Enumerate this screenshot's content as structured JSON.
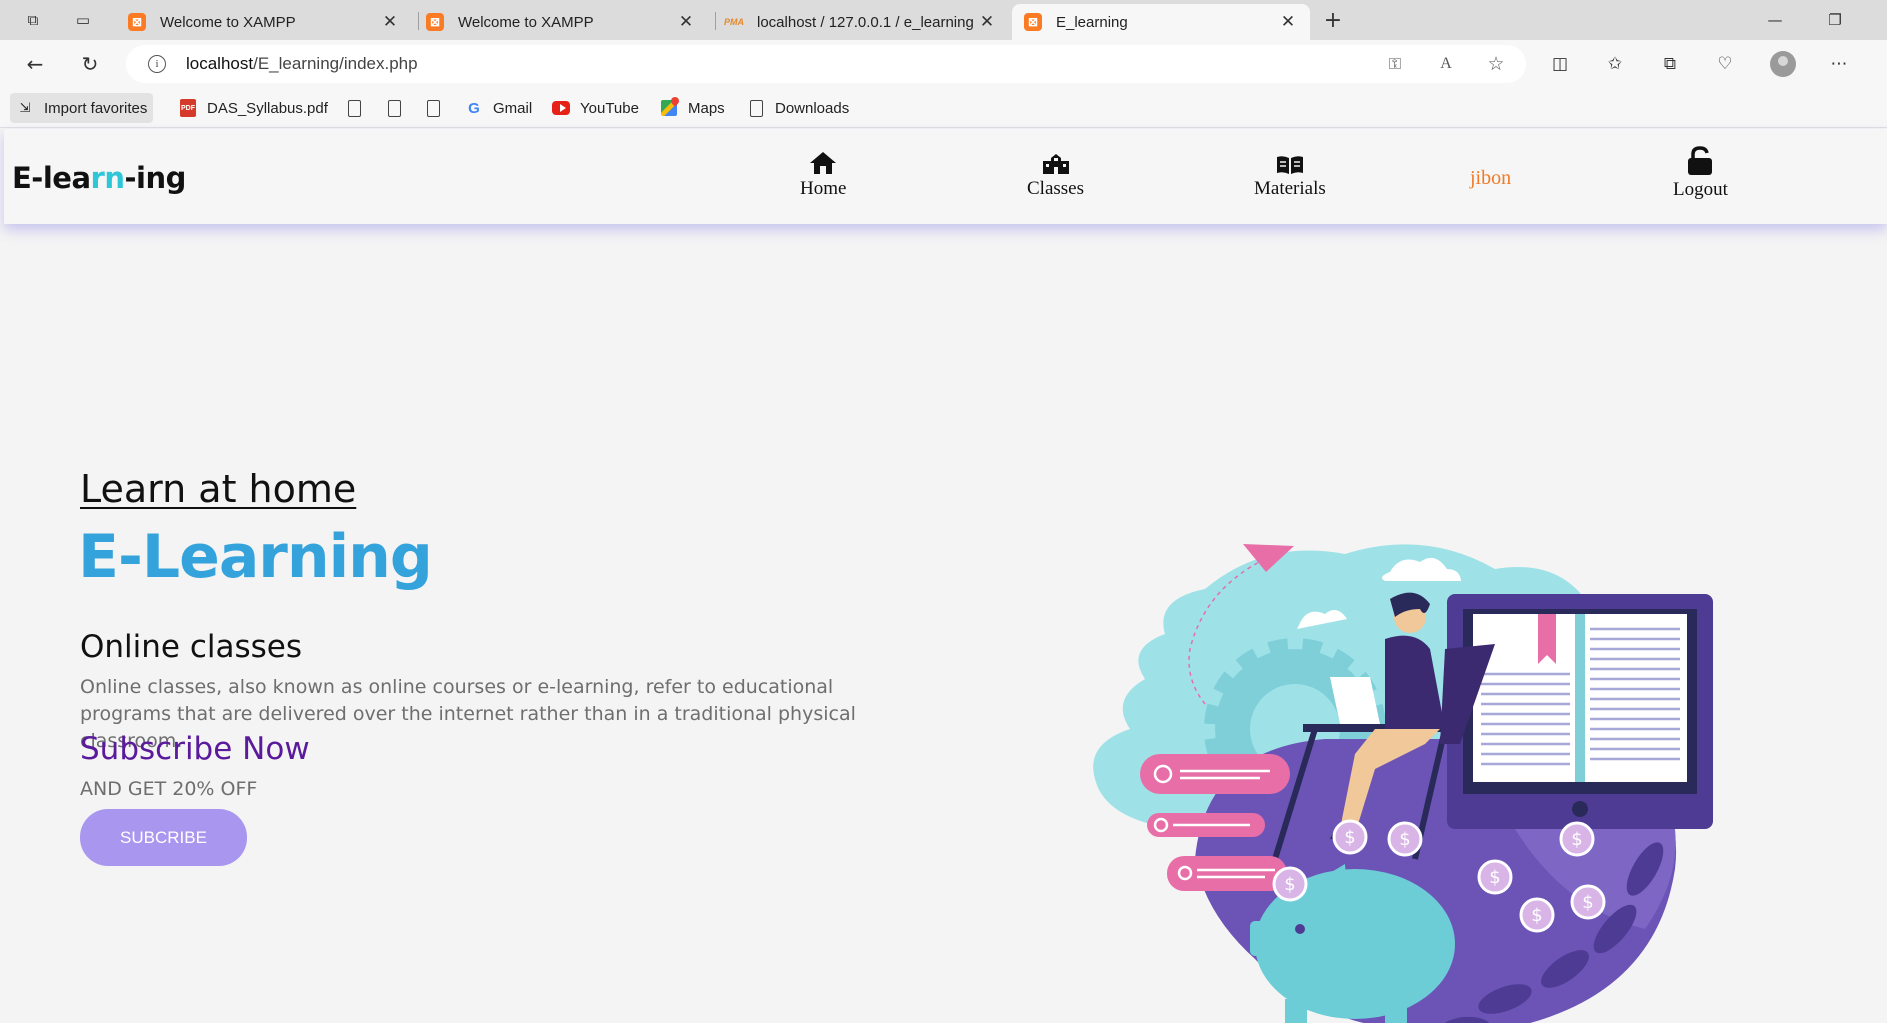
{
  "browser": {
    "tabs": [
      {
        "title": "Welcome to XAMPP",
        "favicon": "xampp-icon",
        "active": false
      },
      {
        "title": "Welcome to XAMPP",
        "favicon": "xampp-icon",
        "active": false
      },
      {
        "title": "localhost / 127.0.0.1 / e_learning",
        "favicon": "phpmyadmin-icon",
        "active": false
      },
      {
        "title": "E_learning",
        "favicon": "xampp-icon",
        "active": true
      }
    ],
    "url_host": "localhost",
    "url_path": "/E_learning/index.php",
    "bookmarks": [
      {
        "label": "Import favorites",
        "icon": "import-icon"
      },
      {
        "label": "DAS_Syllabus.pdf",
        "icon": "pdf-icon"
      },
      {
        "label": "",
        "icon": "file-icon"
      },
      {
        "label": "",
        "icon": "file-icon"
      },
      {
        "label": "",
        "icon": "file-icon"
      },
      {
        "label": "Gmail",
        "icon": "google-icon"
      },
      {
        "label": "YouTube",
        "icon": "youtube-icon"
      },
      {
        "label": "Maps",
        "icon": "maps-icon"
      },
      {
        "label": "Downloads",
        "icon": "file-icon"
      }
    ]
  },
  "site": {
    "logo_prefix": "E-lea",
    "logo_highlight": "rn",
    "logo_suffix": "-ing",
    "nav": {
      "home": "Home",
      "classes": "Classes",
      "materials": "Materials",
      "user": "jibon",
      "logout": "Logout"
    },
    "hero": {
      "subtitle": "Learn at home",
      "title": "E-Learning",
      "section_title": "Online classes",
      "section_desc": "Online classes, also known as online courses or e-learning, refer to educational programs that are delivered over the internet rather than in a traditional physical classroom.",
      "subscribe_heading": "Subscribe Now",
      "offer": "AND GET 20% OFF",
      "button": "SUBCRIBE"
    }
  },
  "colors": {
    "accent_cyan": "#2ec7d8",
    "title_blue": "#35a3db",
    "subscribe_purple": "#5a1a9c",
    "button_purple": "#a996ee",
    "user_orange": "#f07a25"
  }
}
